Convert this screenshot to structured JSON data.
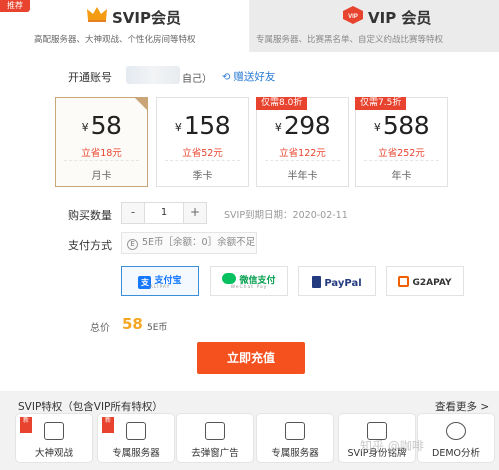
{
  "tabs": {
    "promo_ribbon": "推荐",
    "svip": {
      "title": "SVIP会员",
      "subtitle": "高配服务器、大神观战、个性化房间等特权"
    },
    "vip": {
      "title": "VIP 会员",
      "subtitle": "专属服务器、比赛黑名单、自定义约战比赛等特权"
    }
  },
  "account": {
    "label": "开通账号",
    "self_suffix": "自己）",
    "gift_link": "赠送好友"
  },
  "plans": [
    {
      "currency": "¥",
      "price": "58",
      "save": "立省18元",
      "period": "月卡",
      "tag": ""
    },
    {
      "currency": "¥",
      "price": "158",
      "save": "立省52元",
      "period": "季卡",
      "tag": ""
    },
    {
      "currency": "¥",
      "price": "298",
      "save": "立省122元",
      "period": "半年卡",
      "tag": "仅需8.0折"
    },
    {
      "currency": "¥",
      "price": "588",
      "save": "立省252元",
      "period": "年卡",
      "tag": "仅需7.5折"
    }
  ],
  "quantity": {
    "label": "购买数量",
    "minus": "-",
    "value": "1",
    "plus": "+",
    "expiry": "SVIP到期日期：2020-02-11"
  },
  "payment": {
    "label": "支付方式",
    "balance_coin": "E",
    "balance_text": "5E币［余额：0］余额不足",
    "options": [
      {
        "name": "支付宝",
        "sub": "ALIPAY"
      },
      {
        "name": "微信支付",
        "sub": "WeChat Pay"
      },
      {
        "name": "PayPal",
        "sub": ""
      },
      {
        "name": "G2APAY",
        "sub": ""
      }
    ]
  },
  "total": {
    "label": "总价",
    "value": "58",
    "unit": "5E币"
  },
  "cta": "立即充值",
  "privileges": {
    "title": "SVIP特权（包含VIP所有特权）",
    "see_more": "查看更多 >",
    "new_tag": "新",
    "items": [
      {
        "label": "大神观战",
        "new": true
      },
      {
        "label": "专属服务器",
        "new": true
      },
      {
        "label": "去弹窗广告",
        "new": false
      },
      {
        "label": "专属服务器",
        "new": false
      },
      {
        "label": "SVIP身份铭牌",
        "new": false
      },
      {
        "label": "DEMO分析",
        "new": false
      }
    ]
  },
  "watermark": "知乎 @咖啡"
}
